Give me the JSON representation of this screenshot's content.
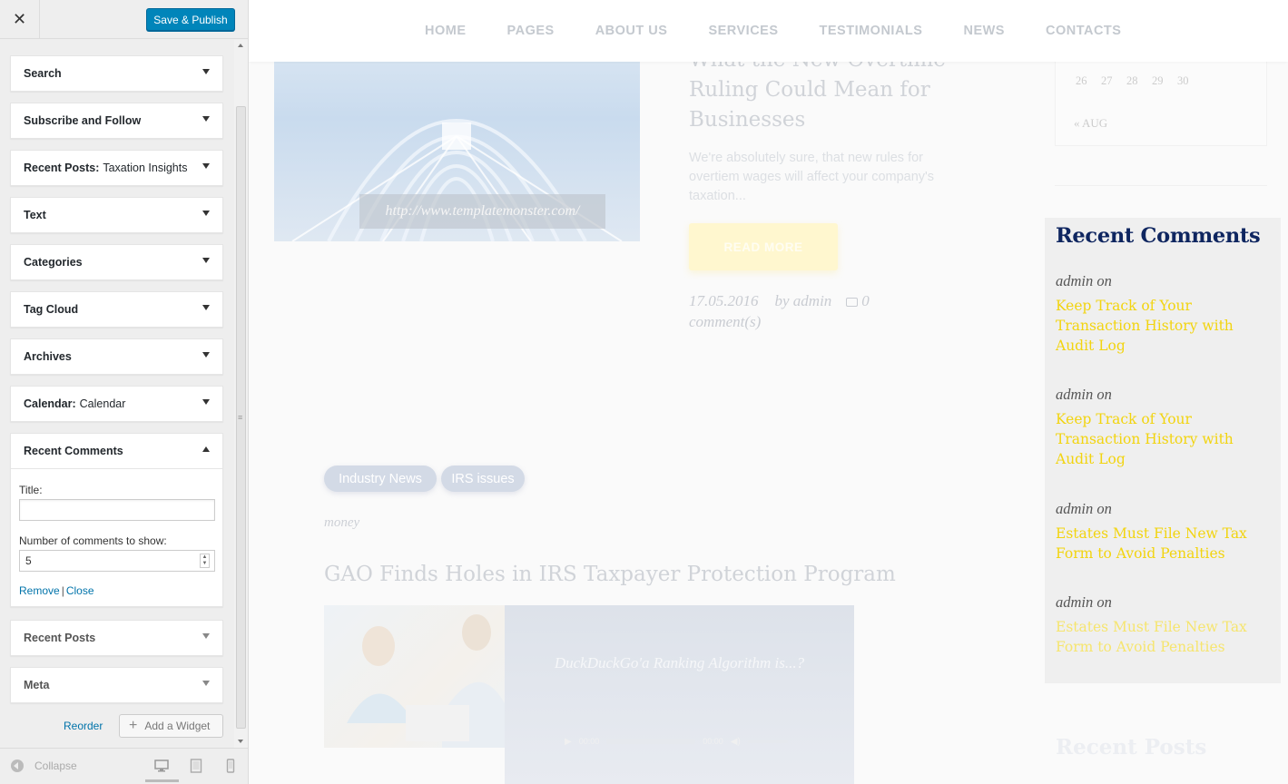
{
  "sidebar": {
    "close_label": "✕",
    "publish_label": "Save & Publish",
    "widgets": [
      {
        "title": "Search",
        "subtitle": ""
      },
      {
        "title": "Subscribe and Follow",
        "subtitle": ""
      },
      {
        "title": "Recent Posts:",
        "subtitle": "Taxation Insights"
      },
      {
        "title": "Text",
        "subtitle": ""
      },
      {
        "title": "Categories",
        "subtitle": ""
      },
      {
        "title": "Tag Cloud",
        "subtitle": ""
      },
      {
        "title": "Archives",
        "subtitle": ""
      },
      {
        "title": "Calendar:",
        "subtitle": "Calendar"
      },
      {
        "title": "Recent Comments",
        "subtitle": ""
      },
      {
        "title": "Recent Posts",
        "subtitle": ""
      },
      {
        "title": "Meta",
        "subtitle": ""
      }
    ],
    "expanded_widget": {
      "title_label": "Title:",
      "title_value": "",
      "count_label": "Number of comments to show:",
      "count_value": "5",
      "remove_label": "Remove",
      "separator": "|",
      "close_label": "Close"
    },
    "reorder_label": "Reorder",
    "add_widget_label": "Add a Widget",
    "collapse_label": "Collapse"
  },
  "preview": {
    "nav": [
      "HOME",
      "PAGES",
      "ABOUT US",
      "SERVICES",
      "TESTIMONIALS",
      "NEWS",
      "CONTACTS"
    ],
    "post1": {
      "image_caption": "http://www.templatemonster.com/",
      "title": "What the New Overtime Ruling Could Mean for Businesses",
      "excerpt": "We're absolutely sure, that new rules for overtiem wages will affect your company's taxation...",
      "read_more": "READ MORE",
      "date": "17.05.2016",
      "author": "by admin",
      "comments_count": "0",
      "comments_label": "comment(s)"
    },
    "post2": {
      "tags": [
        "Industry News",
        "IRS issues"
      ],
      "category": "money",
      "title": "GAO Finds Holes in IRS Taxpayer Protection Program",
      "player_title": "DuckDuckGo'a Ranking Algorithm is...?",
      "time_start": "00:00",
      "time_end": "00:00"
    },
    "calendar": {
      "days": [
        "26",
        "27",
        "28",
        "29",
        "30"
      ],
      "prev_link": "« AUG"
    },
    "recent_comments": {
      "title": "Recent Comments",
      "items": [
        {
          "author": "admin on",
          "link": "Keep Track of Your Transaction History with Audit Log"
        },
        {
          "author": "admin on",
          "link": "Keep Track of Your Transaction History with Audit Log"
        },
        {
          "author": "admin on",
          "link": "Estates Must File New Tax Form to Avoid Penalties"
        },
        {
          "author": "admin on",
          "link": "Estates Must File New Tax Form to Avoid Penalties"
        }
      ]
    },
    "recent_posts_title": "Recent Posts"
  },
  "colors": {
    "publish_button": "#0085ba",
    "link_blue": "#0073aa",
    "comments_heading": "#0f2660",
    "comment_link_yellow": "#f2d40f"
  }
}
